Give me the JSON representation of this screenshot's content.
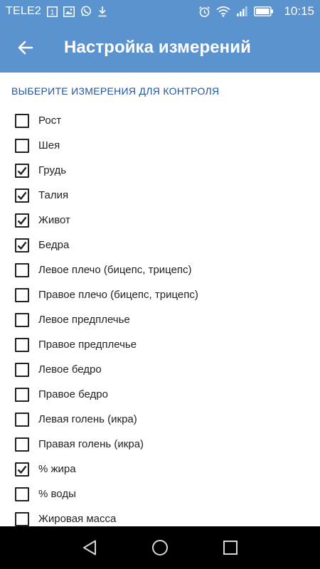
{
  "status_bar": {
    "carrier": "TELE2",
    "sim_badge": "1",
    "time": "10:15",
    "icons": [
      "sim-1-icon",
      "image-icon",
      "whatsapp-icon",
      "download-icon",
      "alarm-icon",
      "wifi-icon",
      "signal-icon",
      "battery-icon"
    ]
  },
  "app_bar": {
    "title": "Настройка измерений",
    "back_icon": "arrow-back-icon"
  },
  "section": {
    "header": "ВЫБЕРИТЕ ИЗМЕРЕНИЯ ДЛЯ КОНТРОЛЯ"
  },
  "items": [
    {
      "label": "Рост",
      "checked": false
    },
    {
      "label": "Шея",
      "checked": false
    },
    {
      "label": "Грудь",
      "checked": true
    },
    {
      "label": "Талия",
      "checked": true
    },
    {
      "label": "Живот",
      "checked": true
    },
    {
      "label": "Бедра",
      "checked": true
    },
    {
      "label": "Левое плечо (бицепс, трицепс)",
      "checked": false
    },
    {
      "label": "Правое плечо (бицепс, трицепс)",
      "checked": false
    },
    {
      "label": "Левое предплечье",
      "checked": false
    },
    {
      "label": "Правое предплечье",
      "checked": false
    },
    {
      "label": "Левое бедро",
      "checked": false
    },
    {
      "label": "Правое бедро",
      "checked": false
    },
    {
      "label": "Левая голень (икра)",
      "checked": false
    },
    {
      "label": "Правая голень (икра)",
      "checked": false
    },
    {
      "label": "% жира",
      "checked": true
    },
    {
      "label": "% воды",
      "checked": false
    },
    {
      "label": "Жировая масса",
      "checked": false
    }
  ],
  "nav_bar": {
    "icons": [
      "back-triangle-icon",
      "home-circle-icon",
      "recents-square-icon"
    ]
  },
  "colors": {
    "primary": "#5a93cd",
    "section_header": "#22559a",
    "nav_bar": "#000000"
  }
}
